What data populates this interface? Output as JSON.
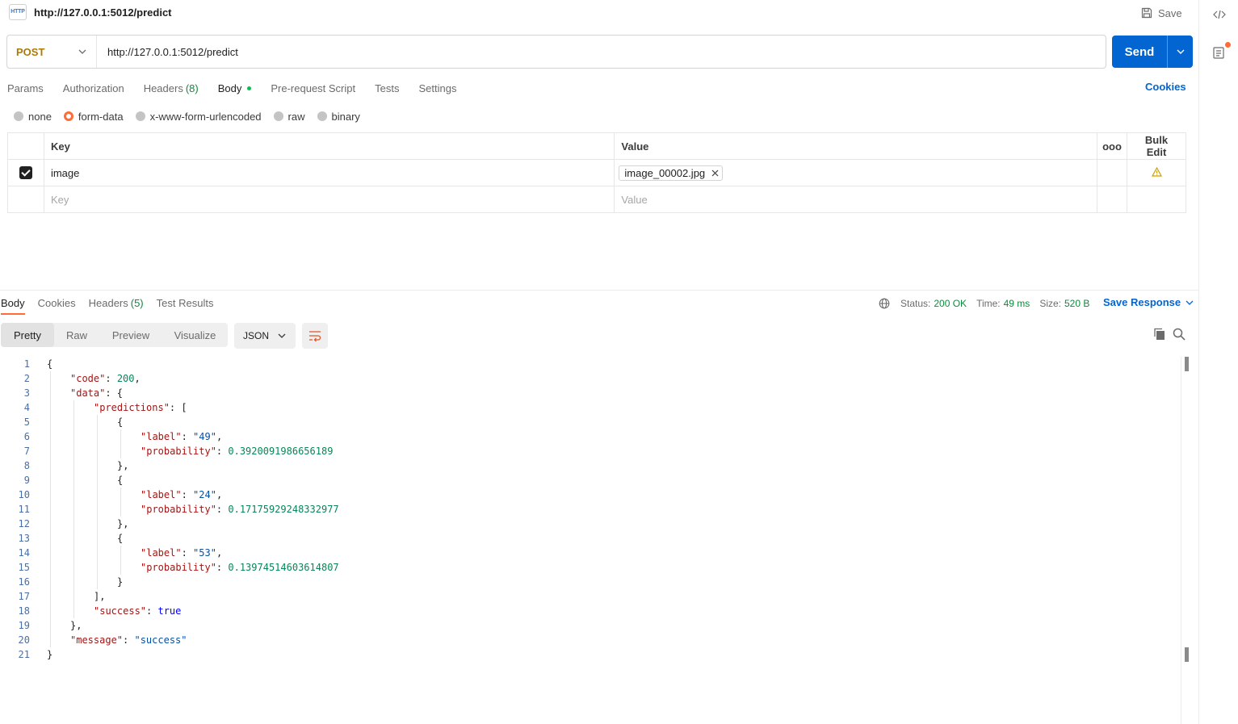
{
  "title_bar": {
    "badge": "HTTP",
    "title": "http://127.0.0.1:5012/predict",
    "save_label": "Save"
  },
  "request": {
    "method": "POST",
    "url": "http://127.0.0.1:5012/predict",
    "send_label": "Send",
    "tabs": [
      {
        "label": "Params"
      },
      {
        "label": "Authorization"
      },
      {
        "label": "Headers",
        "count": "(8)"
      },
      {
        "label": "Body",
        "active": true
      },
      {
        "label": "Pre-request Script"
      },
      {
        "label": "Tests"
      },
      {
        "label": "Settings"
      }
    ],
    "cookies_label": "Cookies",
    "body_modes": [
      {
        "label": "none",
        "selected": false
      },
      {
        "label": "form-data",
        "selected": true
      },
      {
        "label": "x-www-form-urlencoded",
        "selected": false
      },
      {
        "label": "raw",
        "selected": false
      },
      {
        "label": "binary",
        "selected": false
      }
    ],
    "form": {
      "col_key": "Key",
      "col_value": "Value",
      "more_label": "ooo",
      "bulk_edit": "Bulk Edit",
      "rows": [
        {
          "key": "image",
          "file": "image_00002.jpg"
        }
      ],
      "key_placeholder": "Key",
      "value_placeholder": "Value"
    }
  },
  "response": {
    "tabs": [
      {
        "label": "Body",
        "active": true
      },
      {
        "label": "Cookies"
      },
      {
        "label": "Headers",
        "count": "(5)"
      },
      {
        "label": "Test Results"
      }
    ],
    "status_label": "Status:",
    "status_value": "200 OK",
    "time_label": "Time:",
    "time_value": "49 ms",
    "size_label": "Size:",
    "size_value": "520 B",
    "save_response": "Save Response",
    "views": [
      "Pretty",
      "Raw",
      "Preview",
      "Visualize"
    ],
    "active_view": "Pretty",
    "format": "JSON"
  },
  "code_lines": [
    [
      [
        "p",
        "{"
      ]
    ],
    [
      [
        "k",
        "\"code\""
      ],
      [
        "p",
        ": "
      ],
      [
        "n",
        "200"
      ],
      [
        "p",
        ","
      ]
    ],
    [
      [
        "k",
        "\"data\""
      ],
      [
        "p",
        ": {"
      ]
    ],
    [
      [
        "k",
        "\"predictions\""
      ],
      [
        "p",
        ": ["
      ]
    ],
    [
      [
        "p",
        "{"
      ]
    ],
    [
      [
        "k",
        "\"label\""
      ],
      [
        "p",
        ": "
      ],
      [
        "s",
        "\"49\""
      ],
      [
        "p",
        ","
      ]
    ],
    [
      [
        "k",
        "\"probability\""
      ],
      [
        "p",
        ": "
      ],
      [
        "n",
        "0.3920091986656189"
      ]
    ],
    [
      [
        "p",
        "},"
      ]
    ],
    [
      [
        "p",
        "{"
      ]
    ],
    [
      [
        "k",
        "\"label\""
      ],
      [
        "p",
        ": "
      ],
      [
        "s",
        "\"24\""
      ],
      [
        "p",
        ","
      ]
    ],
    [
      [
        "k",
        "\"probability\""
      ],
      [
        "p",
        ": "
      ],
      [
        "n",
        "0.17175929248332977"
      ]
    ],
    [
      [
        "p",
        "},"
      ]
    ],
    [
      [
        "p",
        "{"
      ]
    ],
    [
      [
        "k",
        "\"label\""
      ],
      [
        "p",
        ": "
      ],
      [
        "s",
        "\"53\""
      ],
      [
        "p",
        ","
      ]
    ],
    [
      [
        "k",
        "\"probability\""
      ],
      [
        "p",
        ": "
      ],
      [
        "n",
        "0.13974514603614807"
      ]
    ],
    [
      [
        "p",
        "}"
      ]
    ],
    [
      [
        "p",
        "],"
      ]
    ],
    [
      [
        "k",
        "\"success\""
      ],
      [
        "p",
        ": "
      ],
      [
        "b",
        "true"
      ]
    ],
    [
      [
        "p",
        "},"
      ]
    ],
    [
      [
        "k",
        "\"message\""
      ],
      [
        "p",
        ": "
      ],
      [
        "s",
        "\"success\""
      ]
    ],
    [
      [
        "p",
        "}"
      ]
    ]
  ],
  "colors": {
    "accent": "#ff6c37",
    "primary": "#0265d2",
    "success": "#0e8a3c",
    "method": "#ad7a03"
  }
}
